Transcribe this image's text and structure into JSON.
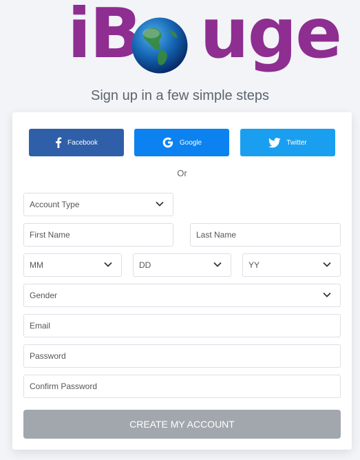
{
  "logo": {
    "text_left": "iB",
    "text_right": "uge"
  },
  "tagline": "Sign up in a few simple steps",
  "social": {
    "facebook": "Facebook",
    "google": "Google",
    "twitter": "Twitter"
  },
  "or_label": "Or",
  "form": {
    "account_type": "Account Type",
    "first_name": "First Name",
    "last_name": "Last Name",
    "month": "MM",
    "day": "DD",
    "year": "YY",
    "gender": "Gender",
    "email": "Email",
    "password": "Password",
    "confirm_password": "Confirm Password"
  },
  "submit_label": "CREATE MY ACCOUNT",
  "colors": {
    "brand_purple": "#8e2e91",
    "facebook": "#2f5fa8",
    "google": "#0b82f0",
    "twitter": "#1a9ff0",
    "submit_disabled": "#a2a7ad"
  },
  "icons": [
    "facebook-icon",
    "google-icon",
    "twitter-icon",
    "chevron-down-icon",
    "globe-icon"
  ]
}
